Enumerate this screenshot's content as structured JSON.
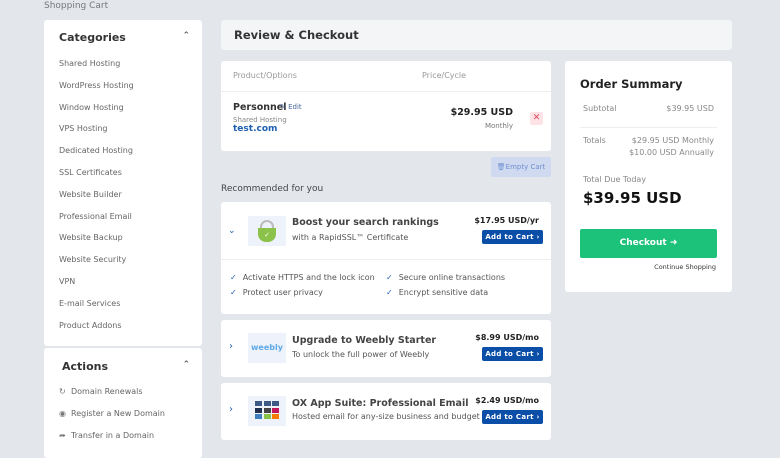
{
  "breadcrumb": "Shopping Cart",
  "sidebar": {
    "categories_title": "Categories",
    "categories": [
      "Shared Hosting",
      "WordPress Hosting",
      "Window Hosting",
      "VPS Hosting",
      "Dedicated Hosting",
      "SSL Certificates",
      "Website Builder",
      "Professional Email",
      "Website Backup",
      "Website Security",
      "VPN",
      "E-mail Services",
      "Product Addons"
    ],
    "actions_title": "Actions",
    "actions": [
      {
        "label": "Domain Renewals",
        "icon": "refresh-icon"
      },
      {
        "label": "Register a New Domain",
        "icon": "globe-icon"
      },
      {
        "label": "Transfer in a Domain",
        "icon": "share-icon"
      }
    ]
  },
  "main": {
    "title": "Review & Checkout",
    "cart": {
      "col_product": "Product/Options",
      "col_price": "Price/Cycle",
      "item": {
        "name": "Personnel",
        "edit": "Edit",
        "group": "Shared Hosting",
        "domain": "test.com",
        "price": "$29.95 USD",
        "cycle": "Monthly"
      },
      "empty_cart": "Empty Cart"
    },
    "recommended_title": "Recommended for you",
    "recommendations": [
      {
        "title": "Boost your search rankings",
        "subtitle": "with a RapidSSL™ Certificate",
        "price": "$17.95 USD/yr",
        "button": "Add to Cart",
        "features": [
          "Activate HTTPS and the lock icon",
          "Secure online transactions",
          "Protect user privacy",
          "Encrypt sensitive data"
        ]
      },
      {
        "title": "Upgrade to Weebly Starter",
        "subtitle": "To unlock the full power of Weebly",
        "price": "$8.99 USD/mo",
        "button": "Add to Cart",
        "logo": "weebly"
      },
      {
        "title": "OX App Suite: Professional Email",
        "subtitle": "Hosted email for any-size business and budget",
        "price": "$2.49 USD/mo",
        "button": "Add to Cart"
      }
    ]
  },
  "summary": {
    "title": "Order Summary",
    "subtotal_label": "Subtotal",
    "subtotal": "$39.95 USD",
    "totals_label": "Totals",
    "totals_monthly": "$29.95 USD Monthly",
    "totals_annually": "$10.00 USD Annually",
    "due_label": "Total Due Today",
    "due": "$39.95 USD",
    "checkout": "Checkout",
    "continue": "Continue Shopping"
  },
  "colors": {
    "accent": "#0b4ea8",
    "checkout": "#1cc27a",
    "bg": "#e3e7ec"
  }
}
